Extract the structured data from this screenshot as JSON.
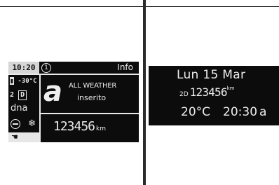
{
  "left_display": {
    "clock": "10:20",
    "info_number": "1",
    "info_label": "Info",
    "temperature": "-30°C",
    "gear_number": "2",
    "gear_letter": "D",
    "dna": "dna",
    "mode_letter": "a",
    "message_line1": "ALL WEATHER",
    "message_line2": "inserito",
    "odometer": "123456",
    "odometer_unit": "km",
    "icons": [
      "thermometer-icon",
      "seat-icon",
      "snowflake-icon",
      "hand-icon"
    ]
  },
  "right_display": {
    "date": "Lun 15 Mar",
    "trip_indicator": "2D",
    "odometer": "123456",
    "odometer_unit": "km",
    "temperature": "20°C",
    "time": "20:30",
    "ampm": "a"
  }
}
